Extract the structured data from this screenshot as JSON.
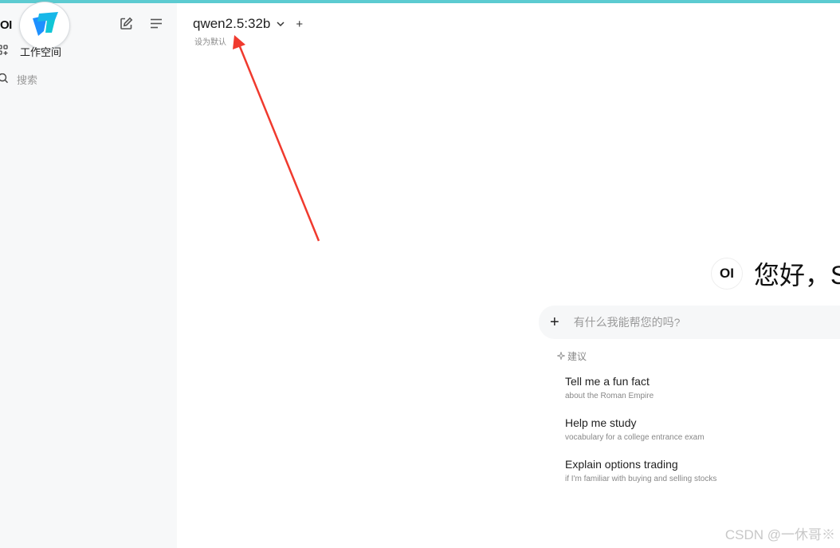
{
  "sidebar": {
    "logo": "OI",
    "workspace_label": "工作空间",
    "search_label": "搜索"
  },
  "model": {
    "name": "qwen2.5:32b",
    "set_default": "设为默认"
  },
  "greeting": {
    "avatar": "OI",
    "text": "您好，S"
  },
  "input": {
    "placeholder": "有什么我能帮您的吗?"
  },
  "suggestions": {
    "heading": "建议",
    "items": [
      {
        "title": "Tell me a fun fact",
        "subtitle": "about the Roman Empire"
      },
      {
        "title": "Help me study",
        "subtitle": "vocabulary for a college entrance exam"
      },
      {
        "title": "Explain options trading",
        "subtitle": "if I'm familiar with buying and selling stocks"
      }
    ]
  },
  "watermark": "CSDN @一休哥※",
  "colors": {
    "accent_bar": "#5ccbd1",
    "annotation_arrow": "#f03a2e",
    "sidebar_bg": "#f7f8f9"
  }
}
